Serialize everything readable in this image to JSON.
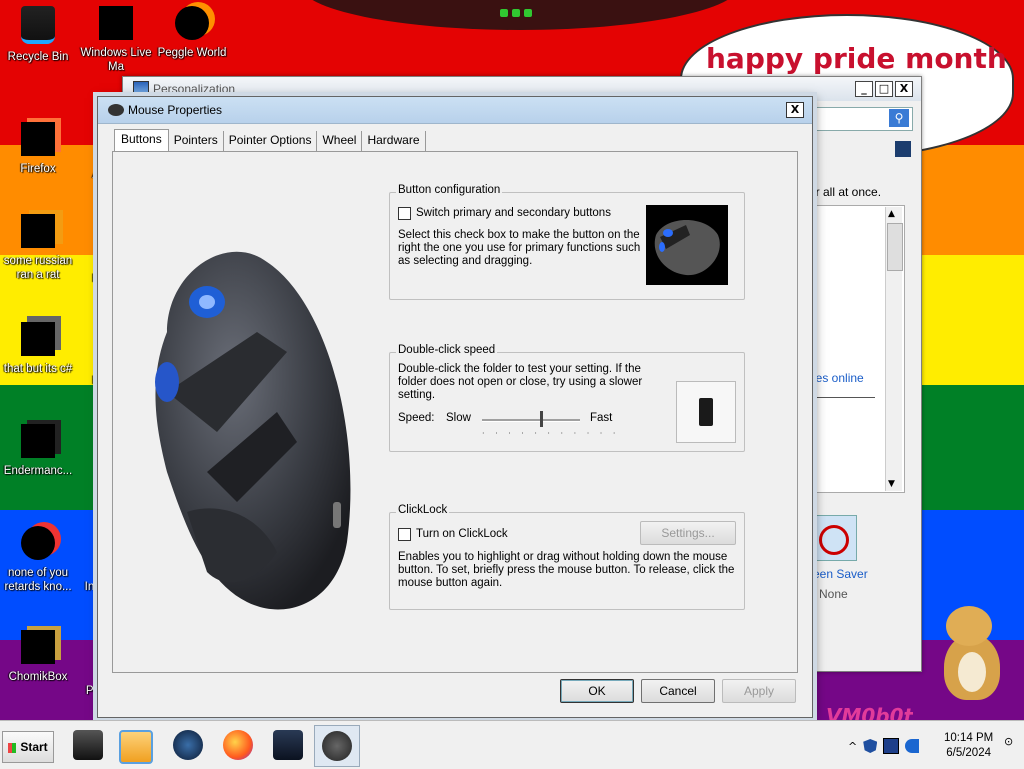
{
  "desktop": {
    "bubble_text": "happy pride month",
    "corner_text": "VM0b0t",
    "icons": [
      {
        "label": "Recycle Bin"
      },
      {
        "label": "Windows Live Ma"
      },
      {
        "label": "Peggle World"
      },
      {
        "label": "Firefox"
      },
      {
        "label": "some russian ran a rat"
      },
      {
        "label": "that but its c#"
      },
      {
        "label": "Endermanc..."
      },
      {
        "label": "none of you retards kno..."
      },
      {
        "label": "ChomikBox"
      }
    ],
    "partial_labels": [
      "A",
      "B",
      "B",
      "Ins",
      "Pe"
    ]
  },
  "personalization": {
    "title": "Personalization",
    "minimize": "_",
    "maximize": "□",
    "close": "X",
    "search_icon": "⚲",
    "text_fragment": "ver all at once.",
    "link_fragment": "nes online",
    "screen_saver_label": "reen Saver",
    "screen_saver_value": "None"
  },
  "dialog": {
    "title": "Mouse Properties",
    "close": "X",
    "tabs": [
      "Buttons",
      "Pointers",
      "Pointer Options",
      "Wheel",
      "Hardware"
    ],
    "active_tab": "Buttons",
    "button_config": {
      "title": "Button configuration",
      "checkbox_label": "Switch primary and secondary buttons",
      "checked": false,
      "description_lines": [
        "Select this check box to make the button on the",
        "right the one you use for primary functions such",
        "as selecting and dragging."
      ]
    },
    "double_click": {
      "title": "Double-click speed",
      "description_lines": [
        "Double-click the folder to test your setting. If the",
        "folder does not open or close, try using a slower",
        "setting."
      ],
      "speed_label": "Speed:",
      "slow": "Slow",
      "fast": "Fast",
      "speed_value": 0.6
    },
    "clicklock": {
      "title": "ClickLock",
      "checkbox_label": "Turn on ClickLock",
      "checked": false,
      "settings_button": "Settings...",
      "description_lines": [
        "Enables you to highlight or drag without holding down the mouse",
        "button. To set, briefly press the mouse button. To release, click the",
        "mouse button again."
      ]
    },
    "buttons": {
      "ok": "OK",
      "cancel": "Cancel",
      "apply": "Apply"
    }
  },
  "taskbar": {
    "start": "Start",
    "apps": [
      "printer-icon",
      "media-player-icon",
      "world-icon",
      "firefox-icon",
      "monitor-icon",
      "mouse-icon"
    ],
    "active_app": "mouse-icon",
    "tray_expand": "^",
    "time": "10:14 PM",
    "date": "6/5/2024"
  }
}
